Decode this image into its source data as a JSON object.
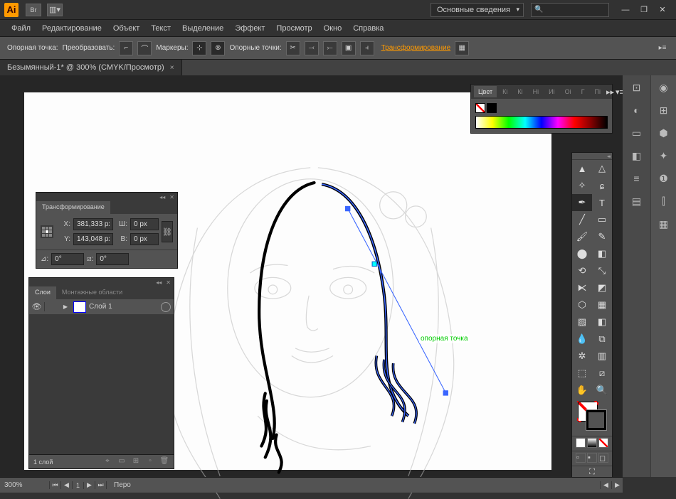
{
  "title": {
    "logo": "Ai",
    "badge": "Br"
  },
  "workspace_dropdown": "Основные сведения",
  "window_buttons": {
    "min": "—",
    "max": "❐",
    "close": "✕"
  },
  "menu": [
    "Файл",
    "Редактирование",
    "Объект",
    "Текст",
    "Выделение",
    "Эффект",
    "Просмотр",
    "Окно",
    "Справка"
  ],
  "control": {
    "anchor_label": "Опорная точка:",
    "convert_label": "Преобразовать:",
    "handles_label": "Маркеры:",
    "anchors_label": "Опорные точки:",
    "transform_link": "Трансформирование"
  },
  "document_tab": "Безымянный-1* @ 300% (CMYK/Просмотр)",
  "color_panel": {
    "title": "Цвет",
    "tabs": [
      "Кі",
      "Кі",
      "Ні",
      "Иі",
      "Оі",
      "Г",
      "Пі"
    ]
  },
  "transform_panel": {
    "title": "Трансформирование",
    "x_label": "X:",
    "x_value": "381,333 px",
    "w_label": "Ш:",
    "w_value": "0 px",
    "y_label": "Y:",
    "y_value": "143,048 px",
    "h_label": "В:",
    "h_value": "0 px",
    "angle_label": "⊿:",
    "angle_value": "0°",
    "shear_label": "⧄:",
    "shear_value": "0°"
  },
  "layers_panel": {
    "tabs": [
      "Слои",
      "Монтажные области"
    ],
    "layer_name": "Слой 1",
    "footer_count": "1 слой"
  },
  "statusbar": {
    "zoom": "300%",
    "tool": "Перо"
  },
  "anchor_tooltip": "опорная точка",
  "dock_icons": [
    "◉",
    "⊞",
    "⬢",
    "✦",
    "❶",
    "⫿",
    "▦",
    "⊡",
    "◐",
    "▭",
    "◧",
    "≡",
    "▤"
  ]
}
